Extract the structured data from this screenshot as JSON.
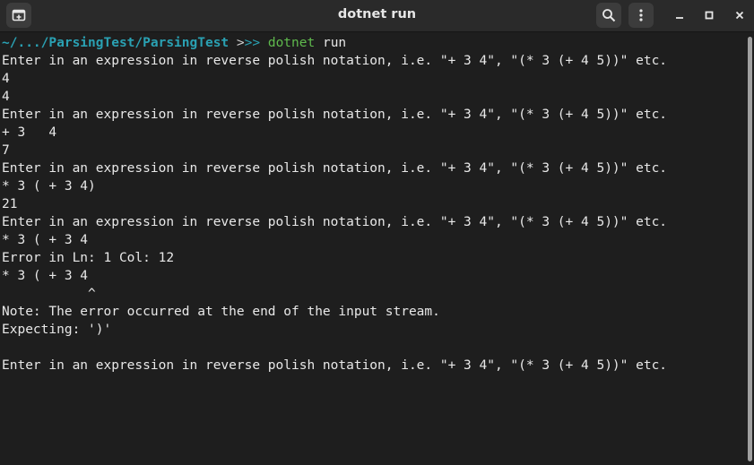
{
  "window": {
    "title": "dotnet run"
  },
  "icons": {
    "new_tab": "new-tab-icon",
    "search": "search-icon",
    "menu": "kebab-menu-icon",
    "minimize": "minimize-icon",
    "maximize": "maximize-icon",
    "close": "close-icon"
  },
  "colors": {
    "background": "#1e1e1e",
    "titlebar": "#2a2a2a",
    "path": "#2aa1b3",
    "command": "#5fb94d",
    "text": "#e8e8e8"
  },
  "prompt": {
    "path": "~/.../ParsingTest/ParsingTest",
    "symbol1": " >",
    "symbol2": ">> ",
    "command": "dotnet",
    "args": " run"
  },
  "output": [
    "Enter in an expression in reverse polish notation, i.e. \"+ 3 4\", \"(* 3 (+ 4 5))\" etc.",
    "4",
    "4",
    "Enter in an expression in reverse polish notation, i.e. \"+ 3 4\", \"(* 3 (+ 4 5))\" etc.",
    "+ 3   4",
    "7",
    "Enter in an expression in reverse polish notation, i.e. \"+ 3 4\", \"(* 3 (+ 4 5))\" etc.",
    "* 3 ( + 3 4)",
    "21",
    "Enter in an expression in reverse polish notation, i.e. \"+ 3 4\", \"(* 3 (+ 4 5))\" etc.",
    "* 3 ( + 3 4",
    "Error in Ln: 1 Col: 12",
    "* 3 ( + 3 4",
    "           ^",
    "Note: The error occurred at the end of the input stream.",
    "Expecting: ')'",
    "",
    "Enter in an expression in reverse polish notation, i.e. \"+ 3 4\", \"(* 3 (+ 4 5))\" etc."
  ]
}
